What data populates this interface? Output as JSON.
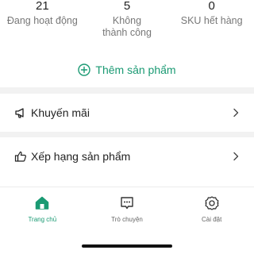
{
  "stats": [
    {
      "value": "21",
      "label": "Đang hoạt động"
    },
    {
      "value": "5",
      "label": "Không thành công"
    },
    {
      "value": "0",
      "label": "SKU hết hàng"
    }
  ],
  "add_product": {
    "label": "Thêm sản phẩm",
    "icon": "plus-circle-icon"
  },
  "menu": [
    {
      "label": "Khuyến mãi",
      "icon": "megaphone-icon"
    },
    {
      "label": "Xếp hạng sản phẩm",
      "icon": "thumbs-up-icon"
    }
  ],
  "nav": [
    {
      "label": "Trang chủ",
      "icon": "home-icon",
      "active": true
    },
    {
      "label": "Trò chuyện",
      "icon": "chat-icon",
      "active": false
    },
    {
      "label": "Cài đặt",
      "icon": "settings-icon",
      "active": false
    }
  ],
  "colors": {
    "accent": "#1a9a73",
    "muted": "#777777",
    "text": "#222222"
  }
}
